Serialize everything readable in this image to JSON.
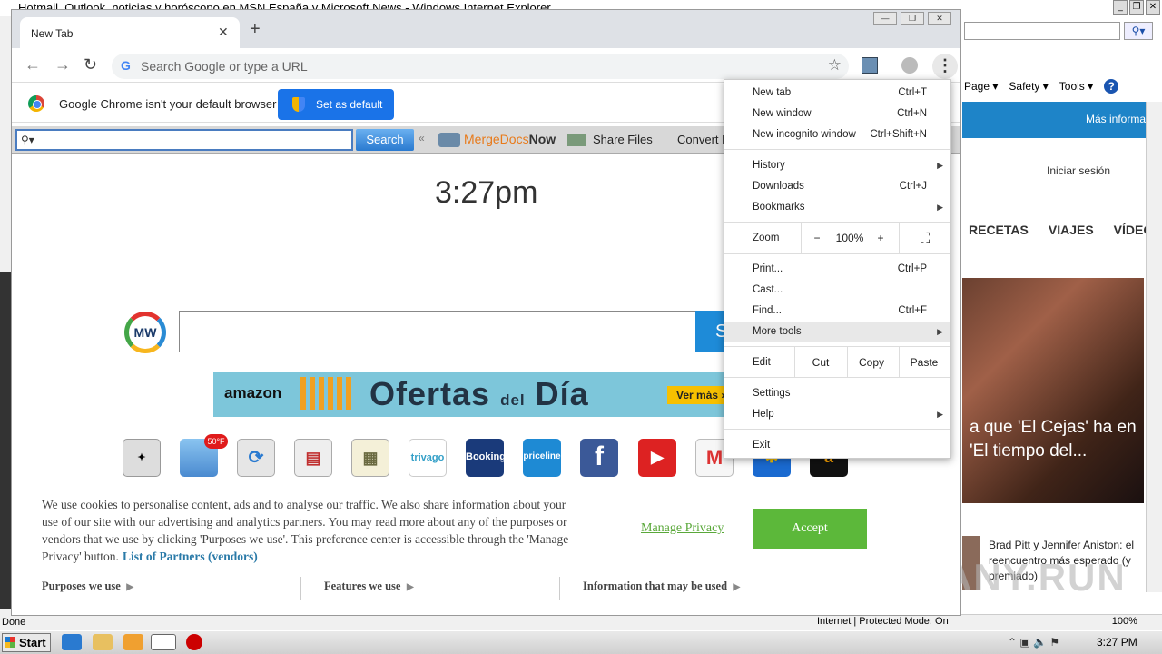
{
  "ie": {
    "title": "Hotmail, Outlook, noticias y horóscopo en MSN España y Microsoft News - Windows Internet Explorer",
    "cmd": [
      "Page ▾",
      "Safety ▾",
      "Tools ▾",
      "?"
    ],
    "more_link": "Más informa",
    "login": "Iniciar sesión",
    "nav": [
      "RECETAS",
      "VIAJES",
      "VÍDEO"
    ],
    "photo_caption": "a que 'El Cejas' ha en 'El tiempo del...",
    "news2": "Brad Pitt y Jennifer Aniston: el reencuentro más esperado (y premiado)",
    "status_left": "Done",
    "status_zone": "Internet | Protected Mode: On",
    "status_zoom": "100%",
    "watermark": "ANY.RUN"
  },
  "chrome": {
    "tab_title": "New Tab",
    "omnibox_placeholder": "Search Google or type a URL",
    "infobar_text": "Google Chrome isn't your default browser",
    "set_default": "Set as default",
    "menu": {
      "new_tab": "New tab",
      "new_tab_sc": "Ctrl+T",
      "new_window": "New window",
      "new_window_sc": "Ctrl+N",
      "incognito": "New incognito window",
      "incognito_sc": "Ctrl+Shift+N",
      "history": "History",
      "downloads": "Downloads",
      "downloads_sc": "Ctrl+J",
      "bookmarks": "Bookmarks",
      "zoom": "Zoom",
      "zoom_minus": "−",
      "zoom_value": "100%",
      "zoom_plus": "+",
      "print": "Print...",
      "print_sc": "Ctrl+P",
      "cast": "Cast...",
      "find": "Find...",
      "find_sc": "Ctrl+F",
      "more_tools": "More tools",
      "edit": "Edit",
      "cut": "Cut",
      "copy": "Copy",
      "paste": "Paste",
      "settings": "Settings",
      "help": "Help",
      "exit": "Exit"
    }
  },
  "mwbar": {
    "search_btn": "Search",
    "merge_a": "MergeDocs",
    "merge_b": "Now",
    "share": "Share Files",
    "convert": "Convert F"
  },
  "newtab": {
    "clock": "3:27pm",
    "mw_logo": "MW",
    "search_btn": "S",
    "amazon": "amazon",
    "ofertas_a": "Ofertas",
    "ofertas_b": "del",
    "ofertas_c": "Día",
    "vermas": "Ver más »",
    "weather_badge": "50°F",
    "tiles": [
      "",
      "",
      "",
      "",
      "",
      "trivago",
      "Booking",
      "priceline",
      "f",
      "▶",
      "M",
      "",
      ""
    ]
  },
  "cookie": {
    "text": "We use cookies to personalise content, ads and to analyse our traffic. We also share information about your use of our site with our advertising and analytics partners. You may read more about any of the purposes or vendors that we use by clicking 'Purposes we use'. This preference center is accessible through the 'Manage Privacy' button.",
    "partners": "List of Partners (vendors)",
    "manage": "Manage Privacy",
    "accept": "Accept",
    "tabs": [
      "Purposes we use",
      "Features we use",
      "Information that may be used"
    ]
  },
  "taskbar": {
    "start": "Start",
    "time": "3:27 PM"
  }
}
